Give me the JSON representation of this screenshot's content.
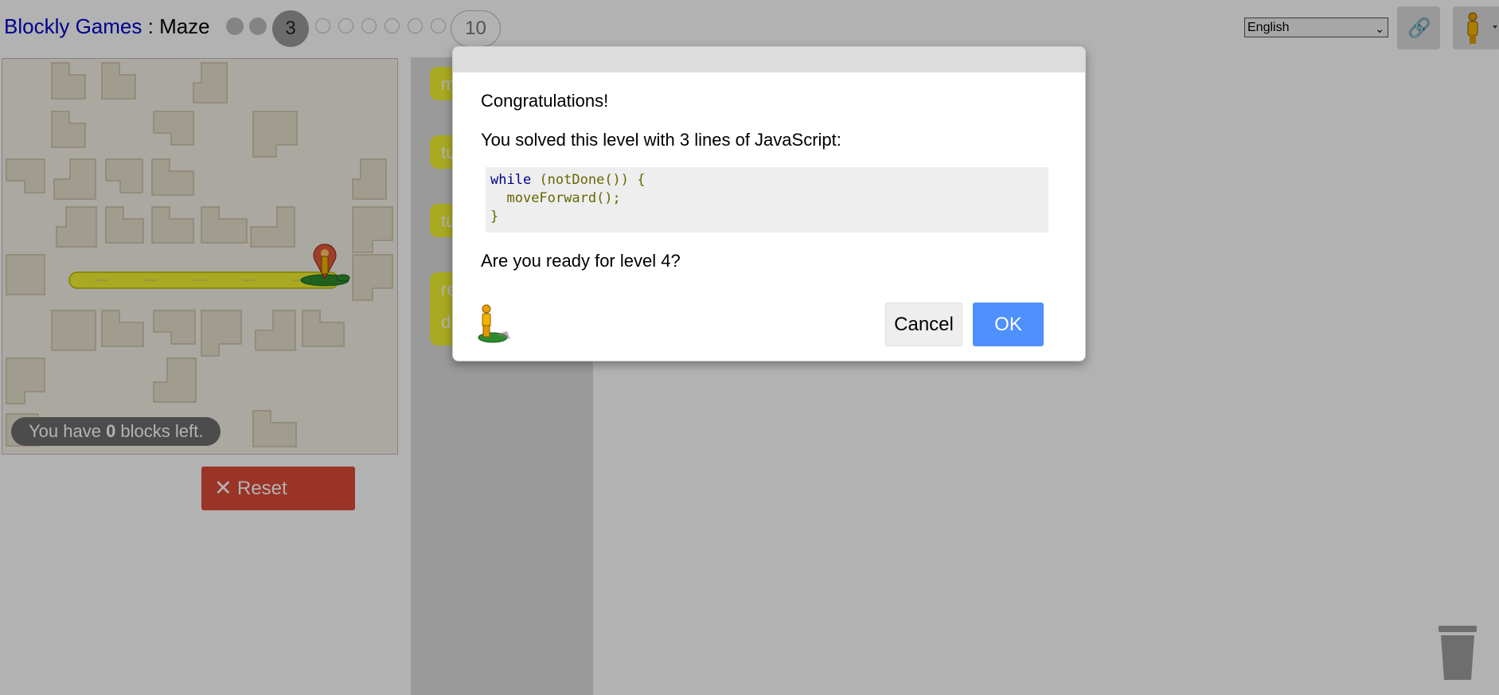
{
  "header": {
    "title_games": "Blockly Games",
    "title_sep": " : ",
    "title_game": "Maze",
    "current_level": "3",
    "last_level": "10",
    "language": "English"
  },
  "maze": {
    "capacity_prefix": "You have ",
    "capacity_count": "0",
    "capacity_suffix": " blocks left."
  },
  "reset_label": "Reset",
  "toolbox_blocks": [
    "m",
    "tu",
    "tu",
    "re",
    "d"
  ],
  "dialog": {
    "congrats": "Congratulations!",
    "solved": "You solved this level with 3 lines of JavaScript:",
    "code": {
      "kw_while": "while",
      "line1_rest": "(notDone()) {",
      "line2": "moveForward();",
      "line3": "}"
    },
    "ready": "Are you ready for level 4?",
    "cancel_label": "Cancel",
    "ok_label": "OK"
  },
  "colors": {
    "reset": "#dd4b39",
    "ok": "#4d90fe",
    "path": "#f2f231",
    "title_link": "#0000cc"
  }
}
